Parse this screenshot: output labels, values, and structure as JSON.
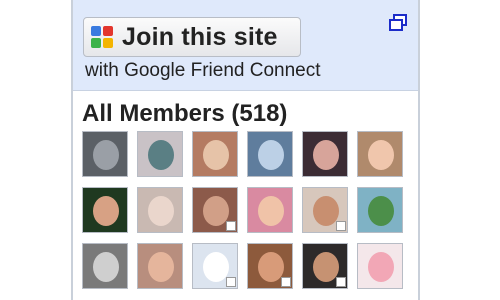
{
  "widget": {
    "join_button_label": "Join this site",
    "subtitle": "with Google Friend Connect",
    "members_title": "All Members (518)",
    "logo_icon": "google-friend-connect-logo-icon",
    "popout_icon": "popout-window-icon"
  },
  "members": [
    {
      "name": "member-1",
      "bg": "#5b6066",
      "face": "#9a9fa6",
      "badge": false
    },
    {
      "name": "member-2",
      "bg": "#c9c2c6",
      "face": "#5a7f84",
      "badge": false
    },
    {
      "name": "member-3",
      "bg": "#b47b62",
      "face": "#e6c3a8",
      "badge": false
    },
    {
      "name": "member-4",
      "bg": "#5f7d9d",
      "face": "#bcd0e6",
      "badge": false
    },
    {
      "name": "member-5",
      "bg": "#3c2c34",
      "face": "#d7a49a",
      "badge": false
    },
    {
      "name": "member-6",
      "bg": "#b08a6c",
      "face": "#f0c6ac",
      "badge": false
    },
    {
      "name": "member-7",
      "bg": "#1f3920",
      "face": "#d7a184",
      "badge": false
    },
    {
      "name": "member-8",
      "bg": "#c9b9b2",
      "face": "#ead6cc",
      "badge": false
    },
    {
      "name": "member-9",
      "bg": "#8c5a4a",
      "face": "#d19f87",
      "badge": true
    },
    {
      "name": "member-10",
      "bg": "#d98aa1",
      "face": "#f0c3a8",
      "badge": false
    },
    {
      "name": "member-11",
      "bg": "#d7c7bc",
      "face": "#c88f70",
      "badge": true
    },
    {
      "name": "member-12",
      "bg": "#7fb2c5",
      "face": "#4c8f4a",
      "badge": false
    },
    {
      "name": "member-13",
      "bg": "#7a7a7a",
      "face": "#cfcfcf",
      "badge": false
    },
    {
      "name": "member-14",
      "bg": "#b88e7e",
      "face": "#e5b59c",
      "badge": false
    },
    {
      "name": "member-15",
      "bg": "#dce4ef",
      "face": "#ffffff",
      "badge": true
    },
    {
      "name": "member-16",
      "bg": "#8d5a3c",
      "face": "#d89b79",
      "badge": true
    },
    {
      "name": "member-17",
      "bg": "#2d2a2a",
      "face": "#c69272",
      "badge": true
    },
    {
      "name": "member-18",
      "bg": "#f4e7ea",
      "face": "#f2a7b6",
      "badge": false
    }
  ]
}
